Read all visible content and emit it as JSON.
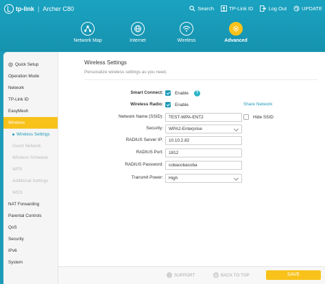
{
  "header": {
    "brand": "tp-link",
    "separator": "|",
    "model": "Archer C80",
    "links": [
      {
        "label": "Search",
        "icon": "search-icon"
      },
      {
        "label": "TP-Link ID",
        "icon": "person-icon"
      },
      {
        "label": "Log Out",
        "icon": "logout-icon"
      },
      {
        "label": "UPDATE",
        "icon": "refresh-icon"
      }
    ]
  },
  "nav": {
    "items": [
      {
        "label": "Network Map",
        "icon": "network-map-icon"
      },
      {
        "label": "Internet",
        "icon": "globe-icon"
      },
      {
        "label": "Wireless",
        "icon": "wifi-icon"
      },
      {
        "label": "Advanced",
        "icon": "gear-icon",
        "active": true
      }
    ]
  },
  "sidebar": {
    "items": [
      {
        "label": "Quick Setup"
      },
      {
        "label": "Operation Mode"
      },
      {
        "label": "Network"
      },
      {
        "label": "TP-Link ID"
      },
      {
        "label": "EasyMesh"
      },
      {
        "label": "Wireless"
      },
      {
        "label": "Wireless Settings"
      },
      {
        "label": "Guest Network"
      },
      {
        "label": "Wireless Schedule"
      },
      {
        "label": "WPS"
      },
      {
        "label": "Additional Settings"
      },
      {
        "label": "WDS"
      },
      {
        "label": "NAT Forwarding"
      },
      {
        "label": "Parental Controls"
      },
      {
        "label": "QoS"
      },
      {
        "label": "Security"
      },
      {
        "label": "IPv6"
      },
      {
        "label": "System"
      }
    ]
  },
  "main": {
    "title": "Wireless Settings",
    "description": "Personalize wireless settings as you need.",
    "smart_connect": {
      "label": "Smart Connect:",
      "option": "Enable",
      "help": "?"
    },
    "wireless_radio": {
      "label": "Wireless Radio:",
      "option": "Enable",
      "share_link": "Share Network"
    },
    "ssid": {
      "label": "Network Name (SSID):",
      "value": "TEST-WPA-ENT2",
      "hide_label": "Hide SSID"
    },
    "security": {
      "label": "Security:",
      "value": "WPA2-Enterprise"
    },
    "radius_ip": {
      "label": "RADIUS Server IP:",
      "value": "10.10.2.82"
    },
    "radius_port": {
      "label": "RADIUS Port:",
      "value": "1812"
    },
    "radius_password": {
      "label": "RADIUS Password:",
      "value": "cobacobacoba"
    },
    "transmit_power": {
      "label": "Transmit Power:",
      "value": "High"
    }
  },
  "footer": {
    "support": "SUPPORT",
    "back_to_top": "BACK TO TOP",
    "save": "SAVE"
  },
  "colors": {
    "header_bg": "#1a9cb9",
    "accent": "#f8c21b",
    "link": "#1d9ab6"
  }
}
